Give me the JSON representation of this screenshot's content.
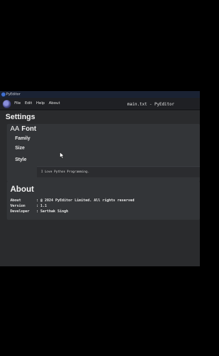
{
  "window": {
    "titlebar_text": "PyEditor"
  },
  "menubar": {
    "items": [
      "File",
      "Edit",
      "Help",
      "About"
    ],
    "title": "main.txt - PyEditor"
  },
  "page": {
    "title": "Settings"
  },
  "font_section": {
    "icon_text": "AA",
    "heading": "Font",
    "labels": {
      "family": "Family",
      "size": "Size",
      "style": "Style"
    },
    "preview_text": "I Love Python Programming."
  },
  "about_section": {
    "heading": "About",
    "rows": [
      {
        "key": "About",
        "sep": ":",
        "value": "@ 2024 PyEditor Limited. All rights reserved"
      },
      {
        "key": "Version",
        "sep": ":",
        "value": "1.1"
      },
      {
        "key": "Developer",
        "sep": ":",
        "value": "Sarthak Singh"
      }
    ]
  },
  "colors": {
    "background": "#2a2b2d",
    "card": "#333538",
    "menubar": "#1f2024",
    "text": "#f2f2f2"
  }
}
